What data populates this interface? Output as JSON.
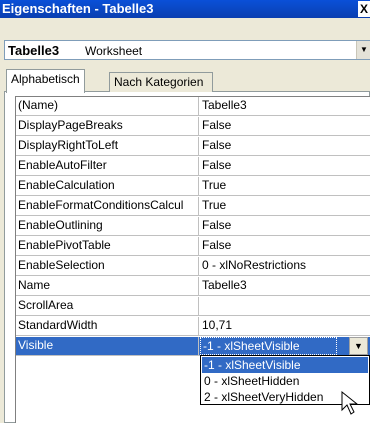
{
  "window": {
    "title": "Eigenschaften - Tabelle3",
    "close_label": "X"
  },
  "object": {
    "name": "Tabelle3",
    "type": "Worksheet"
  },
  "tabs": [
    {
      "label": "Alphabetisch",
      "active": true
    },
    {
      "label": "Nach Kategorien",
      "active": false
    }
  ],
  "properties": [
    {
      "name": "(Name)",
      "value": "Tabelle3"
    },
    {
      "name": "DisplayPageBreaks",
      "value": "False"
    },
    {
      "name": "DisplayRightToLeft",
      "value": "False"
    },
    {
      "name": "EnableAutoFilter",
      "value": "False"
    },
    {
      "name": "EnableCalculation",
      "value": "True"
    },
    {
      "name": "EnableFormatConditionsCalcul",
      "value": "True"
    },
    {
      "name": "EnableOutlining",
      "value": "False"
    },
    {
      "name": "EnablePivotTable",
      "value": "False"
    },
    {
      "name": "EnableSelection",
      "value": "0 - xlNoRestrictions"
    },
    {
      "name": "Name",
      "value": "Tabelle3"
    },
    {
      "name": "ScrollArea",
      "value": ""
    },
    {
      "name": "StandardWidth",
      "value": "10,71"
    },
    {
      "name": "Visible",
      "value": "-1 - xlSheetVisible",
      "selected": true
    }
  ],
  "visible_dropdown": {
    "options": [
      "-1 - xlSheetVisible",
      "0 - xlSheetHidden",
      "2 - xlSheetVeryHidden"
    ],
    "highlighted": "-1 - xlSheetVisible"
  },
  "colors": {
    "title_bar": "#0a4ac0",
    "selection": "#316ac5",
    "dialog_bg": "#ece9d8"
  }
}
